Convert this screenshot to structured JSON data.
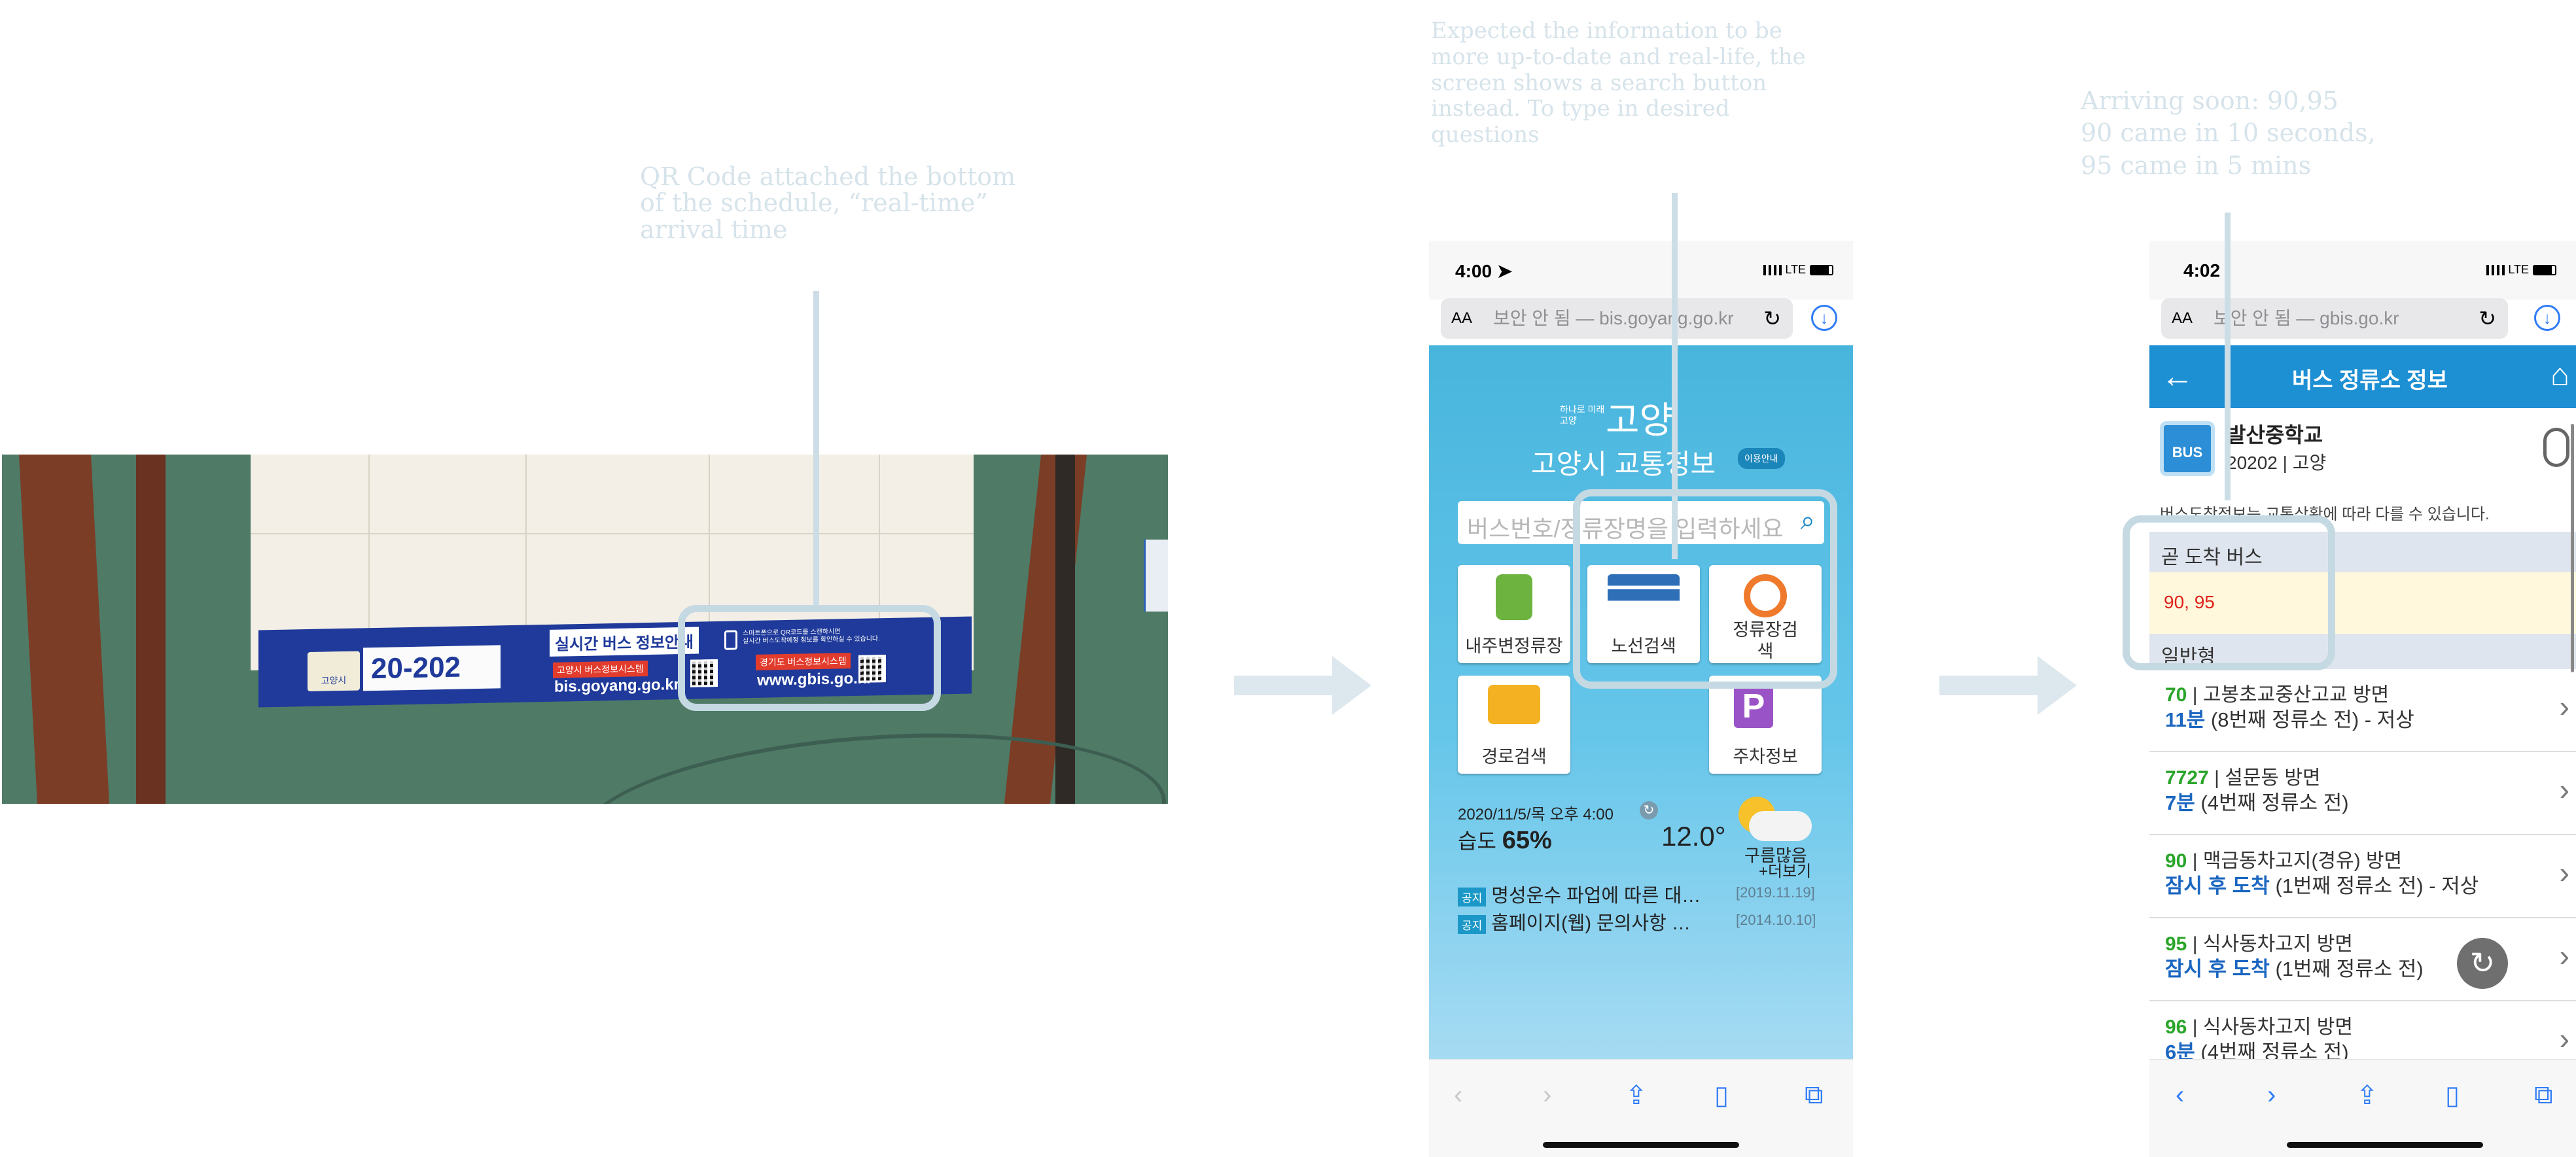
{
  "annotations": {
    "qr_caption": "QR Code attached the bottom\nof the schedule, “real-time”\narrival time",
    "search_caption": "Expected the information to be\nmore up-to-date and real-life, the\nscreen shows a search button\ninstead. To type in desired\nquestions",
    "arriving_caption": "Arriving soon: 90,95\n90 came in 10 seconds,\n95 came in 5 mins"
  },
  "photo": {
    "banner_logo": "고양시",
    "stop_number": "20-202",
    "title": "실시간 버스 정보안내",
    "red_label_1": "고양시 버스정보시스템",
    "red_label_2": "경기도 버스정보시스템",
    "url_1": "bis.goyang.go.kr/",
    "url_2": "www.gbis.go.kr",
    "small_text": "스마트폰으로 QR코드를 스캔하시면\n실시간 버스도착예정 정보를 확인하실 수 있습니다."
  },
  "phone1": {
    "time": "4:00",
    "network": "LTE",
    "url": "보안 안 됨 — bis.goyang.go.kr",
    "aa": "AA",
    "slogan": "하나로 미래 고양",
    "logo": "고양",
    "site_title": "고양시 교통정보",
    "guide_badge": "이용안내",
    "search_placeholder": "버스번호/정류장명을 입력하세요",
    "tiles": [
      {
        "label": "내주변정류장"
      },
      {
        "label": "노선검색"
      },
      {
        "label": "정류장검\n색"
      },
      {
        "label": "경로검색"
      },
      {
        "label": "주차정보"
      }
    ],
    "datetime": "2020/11/5/목 오후 4:00",
    "humidity_label": "습도",
    "humidity": "65%",
    "temperature": "12.0°",
    "weather": "구름많음",
    "more": "+더보기",
    "notices": [
      {
        "tag": "공지",
        "text": "명성운수 파업에 따른 대…",
        "date": "[2019.11.19]"
      },
      {
        "tag": "공지",
        "text": "홈페이지(웹) 문의사항 …",
        "date": "[2014.10.10]"
      }
    ]
  },
  "phone2": {
    "time": "4:02",
    "network": "LTE",
    "url": "보안 안 됨 — gbis.go.kr",
    "aa": "AA",
    "header_title": "버스 정류소 정보",
    "bus_icon": "BUS",
    "stop_name": "발산중학교",
    "stop_id": "20202",
    "stop_region": "고양",
    "stop_note": "버스도착정보는 교통상황에 따라 다를 수 있습니다.",
    "soon_header": "곧 도착 버스",
    "soon_value": "90, 95",
    "regular_header": "일반형",
    "routes": [
      {
        "num": "70",
        "dir": "고봉초교중산고교 방면",
        "eta": "11분",
        "detail": "(8번째 정류소 전) - 저상"
      },
      {
        "num": "7727",
        "dir": "설문동 방면",
        "eta": "7분",
        "detail": "(4번째 정류소 전)"
      },
      {
        "num": "90",
        "dir": "맥금동차고지(경유) 방면",
        "eta": "잠시 후 도착",
        "detail": "(1번째 정류소 전) - 저상"
      },
      {
        "num": "95",
        "dir": "식사동차고지 방면",
        "eta": "잠시 후 도착",
        "detail": "(1번째 정류소 전)"
      },
      {
        "num": "96",
        "dir": "식사동차고지 방면",
        "eta": "6분",
        "detail": "(4번째 정류소 전)"
      }
    ]
  }
}
